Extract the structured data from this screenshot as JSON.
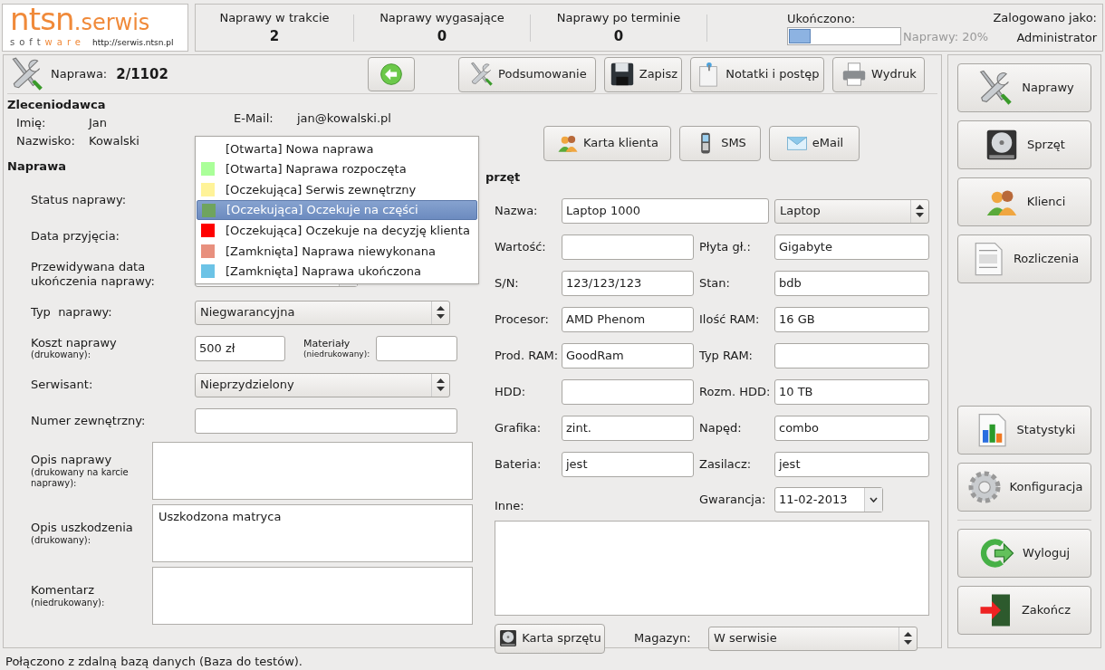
{
  "logo": {
    "brand": "ntsn",
    "suffix": ".serwis",
    "tagline_start": "soft",
    "tagline_end": "ware",
    "url": "http://serwis.ntsn.pl"
  },
  "stats": [
    {
      "label": "Naprawy w trakcie",
      "value": "2"
    },
    {
      "label": "Naprawy wygasające",
      "value": "0"
    },
    {
      "label": "Naprawy po terminie",
      "value": "0"
    }
  ],
  "progress": {
    "label": "Ukończono:",
    "level": 0.2,
    "reading": "Naprawy: 20%"
  },
  "user": {
    "label": "Zalogowano jako:",
    "name": "Administrator"
  },
  "repair": {
    "label": "Naprawa:",
    "number": "2/1102"
  },
  "toolbar": [
    "Podsumowanie",
    "Zapisz",
    "Notatki i postęp",
    "Wydruk"
  ],
  "client": {
    "heading": "Zleceniodawca",
    "fields": [
      {
        "label": "Imię:",
        "value": "Jan"
      },
      {
        "label": "Nazwisko:",
        "value": "Kowalski"
      },
      {
        "label": "E-Mail:",
        "value": "jan@kowalski.pl"
      }
    ],
    "buttons": [
      "Karta klienta",
      "SMS",
      "eMail"
    ]
  },
  "repair_form": {
    "heading": "Naprawa",
    "rows": [
      {
        "kind": "covered",
        "label": "Status naprawy:"
      },
      {
        "kind": "covered",
        "label": "Data przyjęcia:"
      },
      {
        "kind": "date",
        "label": "Przewidywana data ukończenia naprawy:"
      },
      {
        "kind": "select",
        "label": "Typ  naprawy:",
        "value": "Niegwarancyjna"
      },
      {
        "kind": "cost",
        "label": "Koszt naprawy",
        "note": "(drukowany):",
        "value": "500 zł",
        "label2": "Materiały",
        "note2": "(niedrukowany):"
      },
      {
        "kind": "select",
        "label": "Serwisant:",
        "value": "Nieprzydzielony"
      },
      {
        "kind": "text",
        "label": "Numer zewnętrzny:"
      },
      {
        "kind": "area",
        "label": "Opis naprawy",
        "note": "(drukowany na karcie naprawy):"
      },
      {
        "kind": "area",
        "label": "Opis uszkodzenia",
        "note": "(drukowany):",
        "value": "Uszkodzona matryca"
      },
      {
        "kind": "area",
        "label": "Komentarz",
        "note": "(niedrukowany):"
      }
    ]
  },
  "status_menu": [
    {
      "label": "[Otwarta] Nowa naprawa",
      "selected": false
    },
    {
      "label": "[Otwarta] Naprawa rozpoczęta",
      "color": "#aaff99",
      "selected": false
    },
    {
      "label": "[Oczekująca] Serwis zewnętrzny",
      "color": "#fff399",
      "selected": false
    },
    {
      "label": "[Oczekująca] Oczekuje na części",
      "color": "#6fa45e",
      "selected": true
    },
    {
      "label": "[Oczekująca] Oczekuje na decyzję klienta",
      "color": "#ff0000",
      "selected": false
    },
    {
      "label": "[Zamknięta] Naprawa niewykonana",
      "color": "#e8907e",
      "selected": false
    },
    {
      "label": "[Zamknięta] Naprawa ukończona",
      "color": "#6cc3e6",
      "selected": false
    }
  ],
  "equipment": {
    "heading": "przęt",
    "name": {
      "label": "Nazwa:",
      "value": "Laptop 1000",
      "type": "Laptop"
    },
    "pairs": [
      {
        "label": "Wartość:",
        "label2": "Płyta gł.:",
        "value2": "Gigabyte"
      },
      {
        "label": "S/N:",
        "value": "123/123/123",
        "label2": "Stan:",
        "value2": "bdb"
      },
      {
        "label": "Procesor:",
        "value": "AMD Phenom",
        "label2": "Ilość RAM:",
        "value2": "16 GB"
      },
      {
        "label": "Prod. RAM:",
        "value": "GoodRam",
        "label2": "Typ RAM:"
      },
      {
        "label": "HDD:",
        "label2": "Rozm. HDD:",
        "value2": "10 TB"
      },
      {
        "label": "Grafika:",
        "value": "zint.",
        "label2": "Napęd:",
        "value2": "combo"
      },
      {
        "label": "Bateria:",
        "value": "jest",
        "label2": "Zasilacz:",
        "value2": "jest"
      }
    ],
    "warranty": {
      "label": "Gwarancja:",
      "value": "11-02-2013"
    },
    "other_label": "Inne:",
    "card_button": "Karta sprzętu",
    "storage": {
      "label": "Magazyn:",
      "value": "W serwisie"
    }
  },
  "sidebar": {
    "top": [
      "Naprawy",
      "Sprzęt",
      "Klienci",
      "Rozliczenia"
    ],
    "middle": [
      "Statystyki",
      "Konfiguracja"
    ],
    "bottom": [
      "Wyloguj",
      "Zakończ"
    ]
  },
  "status_bar": "Połączono z zdalną bazą danych (Baza do testów)."
}
